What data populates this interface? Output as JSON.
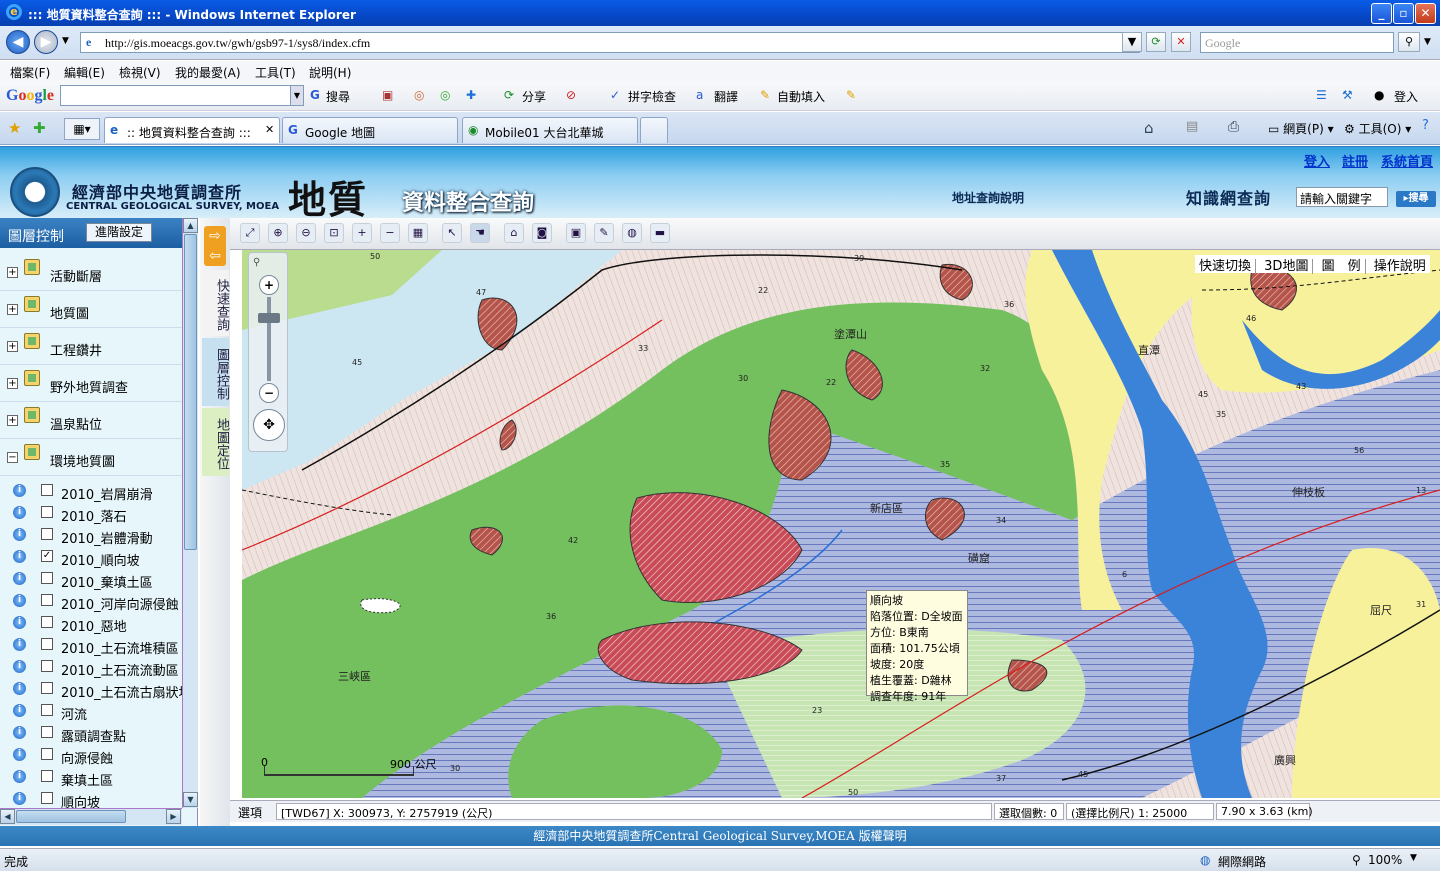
{
  "window": {
    "title": "::: 地質資料整合查詢 ::: - Windows Internet Explorer"
  },
  "address": {
    "url": "http://gis.moeacgs.gov.tw/gwh/gsb97-1/sys8/index.cfm",
    "search_placeholder": "Google"
  },
  "menu": [
    "檔案(F)",
    "編輯(E)",
    "檢視(V)",
    "我的最愛(A)",
    "工具(T)",
    "說明(H)"
  ],
  "google_toolbar": {
    "logo": "Google",
    "items": [
      "搜尋",
      "分享",
      "拼字檢查",
      "翻譯",
      "自動填入",
      "登入"
    ]
  },
  "tabs": [
    ":: 地質資料整合查詢 :::",
    "Google 地圖",
    "Mobile01 大台北華城"
  ],
  "command_bar": {
    "page": "網頁(P)",
    "tools": "工具(O)"
  },
  "header": {
    "agency_zh": "經濟部中央地質調查所",
    "agency_en": "CENTRAL GEOLOGICAL SURVEY, MOEA",
    "title_main": "地質",
    "title_sub": "資料整合查詢",
    "links": [
      "登入",
      "註冊",
      "系統首頁"
    ],
    "address_help": "地址查詢說明",
    "knowledge_label": "知識網查詢",
    "keyword_input": "請輸入關鍵字",
    "search_btn": "搜尋"
  },
  "left_panel": {
    "title": "圖層控制",
    "advanced": "進階設定",
    "layers": [
      "活動斷層",
      "地質圖",
      "工程鑽井",
      "野外地質調查",
      "溫泉點位",
      "環境地質圖"
    ],
    "sublayers": [
      {
        "label": "2010_岩屑崩滑",
        "checked": false
      },
      {
        "label": "2010_落石",
        "checked": false
      },
      {
        "label": "2010_岩體滑動",
        "checked": false
      },
      {
        "label": "2010_順向坡",
        "checked": true
      },
      {
        "label": "2010_棄填土區",
        "checked": false
      },
      {
        "label": "2010_河岸向源侵蝕",
        "checked": false
      },
      {
        "label": "2010_惡地",
        "checked": false
      },
      {
        "label": "2010_土石流堆積區",
        "checked": false
      },
      {
        "label": "2010_土石流流動區",
        "checked": false
      },
      {
        "label": "2010_土石流古扇狀地",
        "checked": false
      },
      {
        "label": "河流",
        "checked": false
      },
      {
        "label": "露頭調查點",
        "checked": false
      },
      {
        "label": "向源侵蝕",
        "checked": false
      },
      {
        "label": "棄填土區",
        "checked": false
      },
      {
        "label": "順向坡",
        "checked": false
      }
    ]
  },
  "side_tabs": [
    "快速查詢",
    "圖層控制",
    "地圖定位"
  ],
  "quick_links": [
    "快速切換",
    "3D地圖",
    "圖　例",
    "操作說明"
  ],
  "map_labels": {
    "places": [
      "塗潭山",
      "直潭",
      "新店區",
      "磺窟",
      "三峽區",
      "屈尺",
      "廣興",
      "伸枝板"
    ],
    "dip_values": [
      "50",
      "39",
      "47",
      "22",
      "36",
      "33",
      "45",
      "30",
      "22",
      "32",
      "45",
      "43",
      "35",
      "35",
      "34",
      "56",
      "42",
      "13",
      "46",
      "36",
      "6",
      "31",
      "23",
      "30",
      "37",
      "45",
      "50"
    ]
  },
  "popup": {
    "title": "順向坡",
    "rows": [
      "陷落位置: D全坡面",
      "方位: B東南",
      "面積: 101.75公頃",
      "坡度: 20度",
      "植生覆蓋: D雜林",
      "調查年度: 91年"
    ]
  },
  "scalebar": {
    "start": "0",
    "end": "900 公尺"
  },
  "status": {
    "option": "選項",
    "coords": "[TWD67] X: 300973, Y: 2757919 (公尺)",
    "selected": "選取個數: 0",
    "scale": "(選擇比例尺) 1: 25000",
    "extent": "7.90 x 3.63 (km)"
  },
  "footer": "經濟部中央地質調查所Central Geological Survey,MOEA 版權聲明",
  "ie_status": {
    "left": "完成",
    "zone": "網際網路",
    "zoom": "100%"
  }
}
